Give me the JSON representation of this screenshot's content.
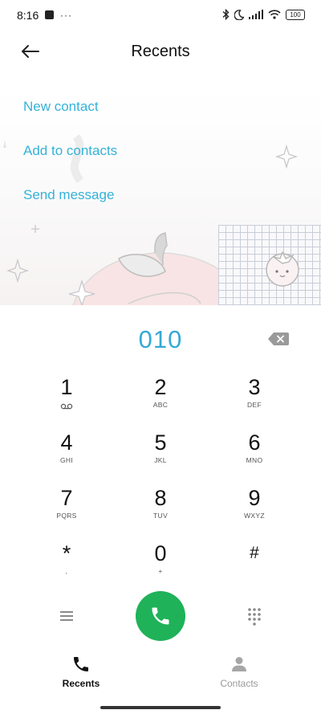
{
  "status_bar": {
    "time": "8:16",
    "battery": "100",
    "notification_dots": "···"
  },
  "header": {
    "title": "Recents",
    "back_icon": "arrow-left-icon"
  },
  "actions": [
    {
      "label": "New contact"
    },
    {
      "label": "Add to contacts"
    },
    {
      "label": "Send message"
    }
  ],
  "dialer": {
    "number": "010",
    "keys": [
      {
        "digit": "1",
        "letters": ""
      },
      {
        "digit": "2",
        "letters": "ABC"
      },
      {
        "digit": "3",
        "letters": "DEF"
      },
      {
        "digit": "4",
        "letters": "GHI"
      },
      {
        "digit": "5",
        "letters": "JKL"
      },
      {
        "digit": "6",
        "letters": "MNO"
      },
      {
        "digit": "7",
        "letters": "PQRS"
      },
      {
        "digit": "8",
        "letters": "TUV"
      },
      {
        "digit": "9",
        "letters": "WXYZ"
      },
      {
        "digit": "*",
        "letters": ","
      },
      {
        "digit": "0",
        "letters": "+"
      },
      {
        "digit": "#",
        "letters": ""
      }
    ]
  },
  "nav": {
    "recents_label": "Recents",
    "contacts_label": "Contacts"
  },
  "colors": {
    "accent": "#35b2d8",
    "call_green": "#1fb259"
  }
}
